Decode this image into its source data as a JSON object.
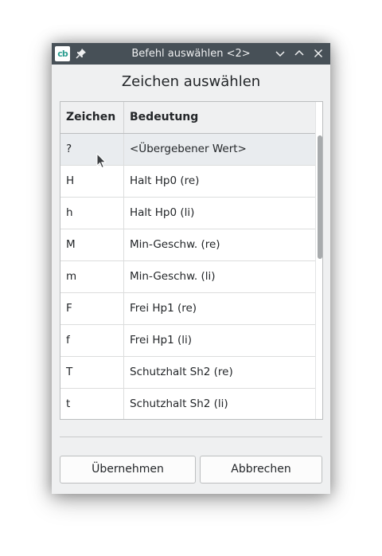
{
  "window": {
    "title": "Befehl auswählen <2>",
    "app_icon_text": "cb"
  },
  "dialog": {
    "heading": "Zeichen auswählen"
  },
  "table": {
    "columns": [
      "Zeichen",
      "Bedeutung"
    ],
    "rows": [
      {
        "zeichen": "?",
        "bedeutung": "<Übergebener Wert>",
        "selected": true
      },
      {
        "zeichen": "H",
        "bedeutung": "Halt Hp0 (re)"
      },
      {
        "zeichen": "h",
        "bedeutung": "Halt Hp0 (li)"
      },
      {
        "zeichen": "M",
        "bedeutung": "Min-Geschw. (re)"
      },
      {
        "zeichen": "m",
        "bedeutung": "Min-Geschw. (li)"
      },
      {
        "zeichen": "F",
        "bedeutung": "Frei Hp1 (re)"
      },
      {
        "zeichen": "f",
        "bedeutung": "Frei Hp1 (li)"
      },
      {
        "zeichen": "T",
        "bedeutung": "Schutzhalt Sh2 (re)"
      },
      {
        "zeichen": "t",
        "bedeutung": "Schutzhalt Sh2 (li)"
      },
      {
        "zeichen": "",
        "bedeutung": ""
      }
    ]
  },
  "buttons": {
    "ok_label": "Übernehmen",
    "cancel_label": "Abbrechen"
  },
  "icons": {
    "app": "app-logo-icon",
    "pin": "pin-icon",
    "minimize": "chevron-down-icon",
    "maximize": "chevron-up-icon",
    "close": "close-icon",
    "cursor": "mouse-pointer-icon"
  },
  "colors": {
    "titlebar": "#475057",
    "window_bg": "#eff0f1",
    "selected_row": "#e9ecef",
    "app_icon_accent": "#2a9d8f"
  }
}
